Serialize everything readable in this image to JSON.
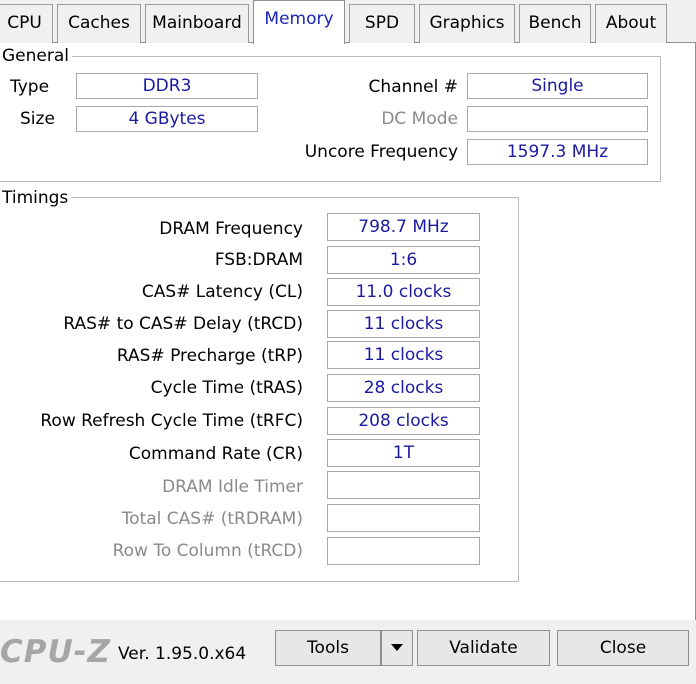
{
  "tabs": [
    {
      "label": "CPU"
    },
    {
      "label": "Caches"
    },
    {
      "label": "Mainboard"
    },
    {
      "label": "Memory"
    },
    {
      "label": "SPD"
    },
    {
      "label": "Graphics"
    },
    {
      "label": "Bench"
    },
    {
      "label": "About"
    }
  ],
  "active_tab": "Memory",
  "general": {
    "title": "General",
    "type_label": "Type",
    "type_value": "DDR3",
    "size_label": "Size",
    "size_value": "4 GBytes",
    "channel_label": "Channel #",
    "channel_value": "Single",
    "dcmode_label": "DC Mode",
    "dcmode_value": "",
    "uncore_label": "Uncore Frequency",
    "uncore_value": "1597.3 MHz"
  },
  "timings": {
    "title": "Timings",
    "rows": [
      {
        "label": "DRAM Frequency",
        "value": "798.7 MHz",
        "enabled": true
      },
      {
        "label": "FSB:DRAM",
        "value": "1:6",
        "enabled": true
      },
      {
        "label": "CAS# Latency (CL)",
        "value": "11.0 clocks",
        "enabled": true
      },
      {
        "label": "RAS# to CAS# Delay (tRCD)",
        "value": "11 clocks",
        "enabled": true
      },
      {
        "label": "RAS# Precharge (tRP)",
        "value": "11 clocks",
        "enabled": true
      },
      {
        "label": "Cycle Time (tRAS)",
        "value": "28 clocks",
        "enabled": true
      },
      {
        "label": "Row Refresh Cycle Time (tRFC)",
        "value": "208 clocks",
        "enabled": true
      },
      {
        "label": "Command Rate (CR)",
        "value": "1T",
        "enabled": true
      },
      {
        "label": "DRAM Idle Timer",
        "value": "",
        "enabled": false
      },
      {
        "label": "Total CAS# (tRDRAM)",
        "value": "",
        "enabled": false
      },
      {
        "label": "Row To Column (tRCD)",
        "value": "",
        "enabled": false
      }
    ]
  },
  "footer": {
    "logo": "CPU-Z",
    "version": "Ver. 1.95.0.x64",
    "tools_label": "Tools",
    "validate_label": "Validate",
    "close_label": "Close"
  },
  "colors": {
    "accent_text": "#1a26b8",
    "field_text": "#1a1aa0",
    "disabled_text": "#8a8a8a"
  }
}
